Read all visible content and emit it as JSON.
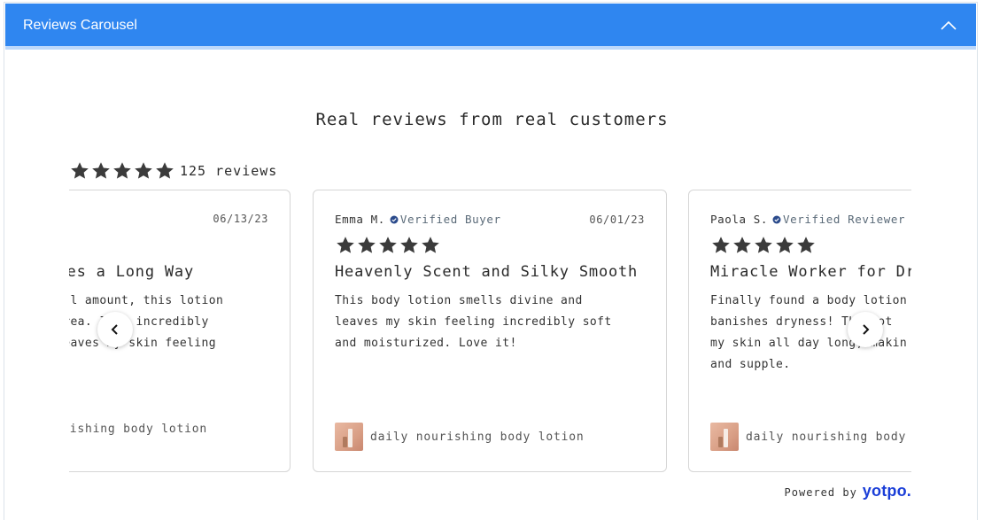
{
  "header": {
    "title": "Reviews Carousel"
  },
  "widget": {
    "headline": "Real reviews from real customers",
    "rating": 5,
    "review_count_label": "125 reviews"
  },
  "colors": {
    "header": "#2f86f0",
    "star": "#3b3b3b",
    "verified": "#2b4b8c",
    "brand": "#1a3ed8"
  },
  "reviews": [
    {
      "date": "06/13/23",
      "title": "es a Long Way",
      "body_lines": [
        "all amount, this lotion",
        "area. It's incredibly",
        "leaves my skin feeling",
        "."
      ],
      "product": "ishing body lotion"
    },
    {
      "name": "Emma M.",
      "badge": "Verified Buyer",
      "date": "06/01/23",
      "title": "Heavenly Scent and Silky Smooth",
      "body_lines": [
        "This body lotion smells divine and",
        "leaves my skin feeling incredibly soft",
        "and moisturized. Love it!"
      ],
      "product": "daily nourishing body lotion"
    },
    {
      "name": "Paola S.",
      "badge": "Verified Reviewer",
      "title": "Miracle Worker for Dr",
      "body_lines": [
        "Finally found a body lotion",
        "banishes dryness! The lot",
        "my skin all day long, makin",
        "and supple."
      ],
      "product": "daily nourishing body"
    }
  ],
  "footer": {
    "powered_by": "Powered by",
    "brand": "yotpo."
  },
  "icons": {
    "collapse": "chevron-up-icon",
    "prev": "chevron-left-icon",
    "next": "chevron-right-icon",
    "star": "star-icon",
    "verified": "verified-check-icon"
  }
}
